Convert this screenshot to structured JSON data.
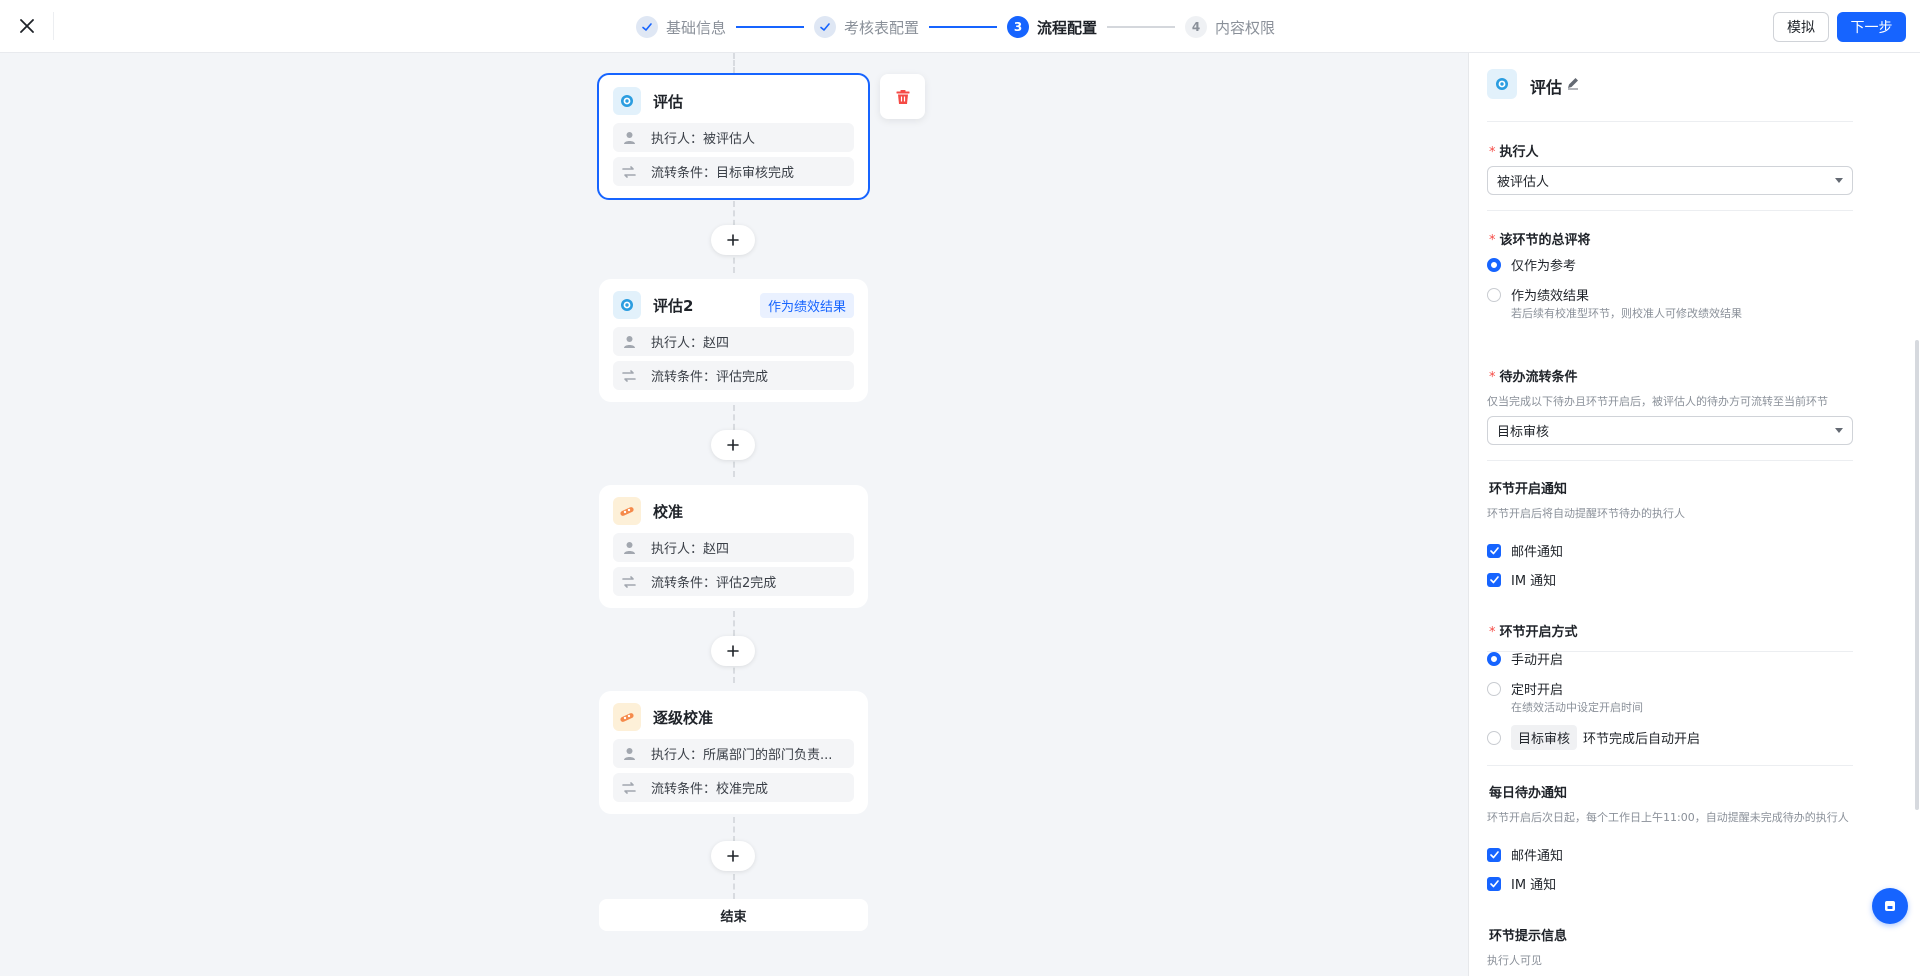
{
  "steps": [
    {
      "num": "",
      "label": "基础信息",
      "state": "done"
    },
    {
      "num": "",
      "label": "考核表配置",
      "state": "done"
    },
    {
      "num": "3",
      "label": "流程配置",
      "state": "active"
    },
    {
      "num": "4",
      "label": "内容权限",
      "state": "todo"
    }
  ],
  "toolbar": {
    "simulate": "模拟",
    "next": "下一步"
  },
  "flow": {
    "nodes": [
      {
        "title": "评估",
        "tag": "",
        "icon": "target-icon",
        "executor": "执行人：被评估人",
        "condition": "流转条件：目标审核完成"
      },
      {
        "title": "评估2",
        "tag": "作为绩效结果",
        "icon": "target-icon",
        "executor": "执行人：赵四",
        "condition": "流转条件：评估完成"
      },
      {
        "title": "校准",
        "tag": "",
        "icon": "calibrate-icon",
        "executor": "执行人：赵四",
        "condition": "流转条件：评估2完成"
      },
      {
        "title": "逐级校准",
        "tag": "",
        "icon": "calibrate-icon",
        "executor": "执行人：所属部门的部门负责...",
        "condition": "流转条件：校准完成"
      }
    ],
    "add_symbol": "+",
    "end_label": "结束"
  },
  "panel": {
    "title": "评估",
    "executor": {
      "label": "执行人",
      "value": "被评估人"
    },
    "summary": {
      "label": "该环节的总评将",
      "options": [
        {
          "label": "仅作为参考",
          "hint": ""
        },
        {
          "label": "作为绩效结果",
          "hint": "若后续有校准型环节，则校准人可修改绩效结果"
        }
      ],
      "selected": 0
    },
    "todo_condition": {
      "label": "待办流转条件",
      "hint": "仅当完成以下待办且环节开启后，被评估人的待办方可流转至当前环节",
      "value": "目标审核"
    },
    "start_notice": {
      "label": "环节开启通知",
      "hint": "环节开启后将自动提醒环节待办的执行人",
      "options": [
        "邮件通知",
        "IM 通知"
      ]
    },
    "start_mode": {
      "label": "环节开启方式",
      "options": [
        {
          "label": "手动开启",
          "hint": ""
        },
        {
          "label": "定时开启",
          "hint": "在绩效活动中设定开启时间"
        }
      ],
      "auto_chip": "目标审核",
      "auto_text": "环节完成后自动开启",
      "selected": 0
    },
    "daily_notice": {
      "label": "每日待办通知",
      "hint": "环节开启后次日起，每个工作日上午11:00，自动提醒未完成待办的执行人",
      "options": [
        "邮件通知",
        "IM 通知"
      ]
    },
    "tip_info": {
      "label": "环节提示信息",
      "hint": "执行人可见"
    }
  },
  "colors": {
    "primary": "#1664ff",
    "danger": "#f54a45",
    "canvas_bg": "#f3f5f8"
  }
}
